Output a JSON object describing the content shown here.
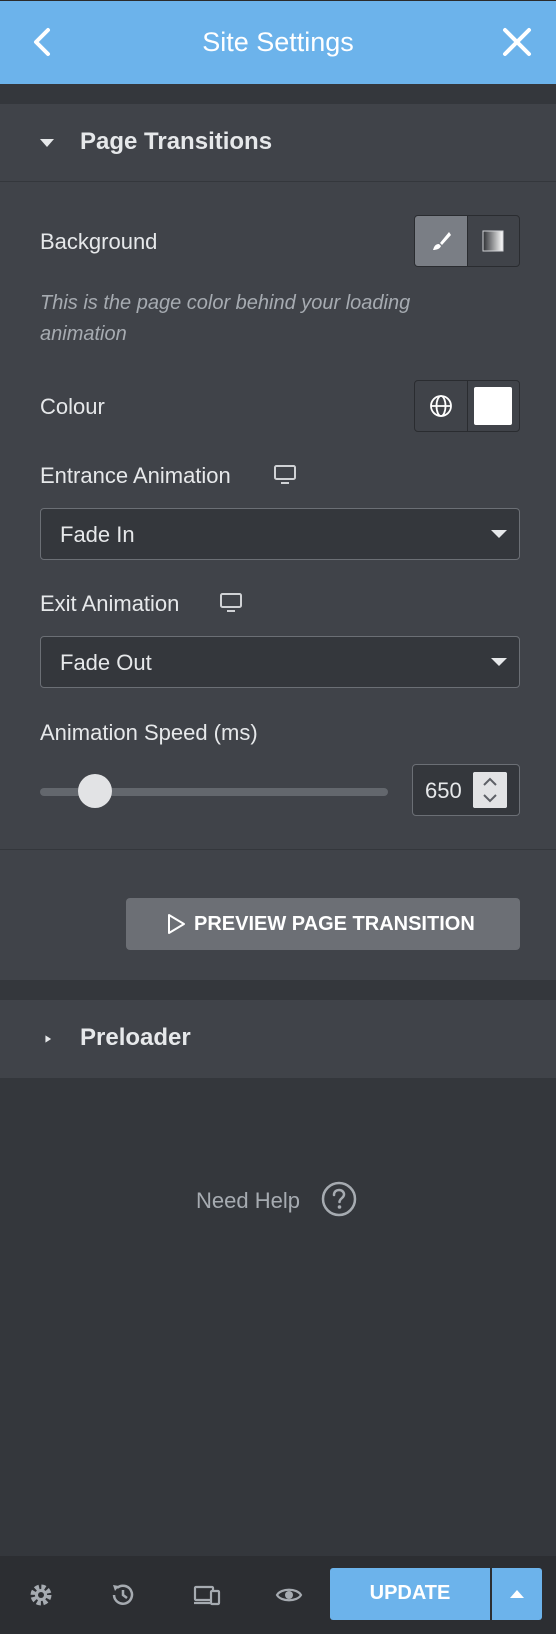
{
  "header": {
    "title": "Site Settings"
  },
  "page_transitions": {
    "heading": "Page Transitions",
    "background_label": "Background",
    "background_description": "This is the page color behind your loading animation",
    "colour_label": "Colour",
    "colour_value": "#ffffff",
    "entrance_label": "Entrance Animation",
    "entrance_value": "Fade In",
    "exit_label": "Exit Animation",
    "exit_value": "Fade Out",
    "speed_label": "Animation Speed (ms)",
    "speed_value": "650",
    "speed_slider_fraction": 0.12,
    "preview_label": "PREVIEW PAGE TRANSITION"
  },
  "preloader": {
    "heading": "Preloader"
  },
  "help": {
    "label": "Need Help"
  },
  "footer": {
    "update_label": "UPDATE"
  },
  "colors": {
    "accent": "#6cb3eb",
    "panel": "#404349",
    "background": "#34373c"
  }
}
